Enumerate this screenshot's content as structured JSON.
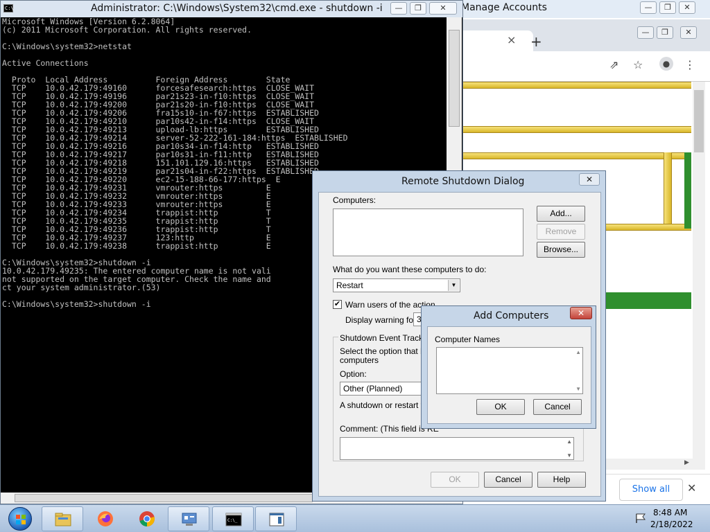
{
  "browser": {
    "title": "Manage Accounts",
    "tab_close": "×",
    "new_tab": "+",
    "show_all": "Show all",
    "download_close": "✕",
    "minimize": "—",
    "maximize": "❐",
    "close": "✕"
  },
  "cmd": {
    "title": "Administrator: C:\\Windows\\System32\\cmd.exe - shutdown  -i",
    "icon_text": "C:\\",
    "minimize": "—",
    "maximize": "❐",
    "close": "✕",
    "lines": [
      "Microsoft Windows [Version 6.2.8064]",
      "(c) 2011 Microsoft Corporation. All rights reserved.",
      "",
      "C:\\Windows\\system32>netstat",
      "",
      "Active Connections",
      "",
      "  Proto  Local Address          Foreign Address        State",
      "  TCP    10.0.42.179:49160      forcesafesearch:https  CLOSE_WAIT",
      "  TCP    10.0.42.179:49196      par21s23-in-f10:https  CLOSE_WAIT",
      "  TCP    10.0.42.179:49200      par21s20-in-f10:https  CLOSE_WAIT",
      "  TCP    10.0.42.179:49206      fra15s10-in-f67:https  ESTABLISHED",
      "  TCP    10.0.42.179:49210      par10s42-in-f14:https  CLOSE_WAIT",
      "  TCP    10.0.42.179:49213      upload-lb:https        ESTABLISHED",
      "  TCP    10.0.42.179:49214      server-52-222-161-184:https  ESTABLISHED",
      "  TCP    10.0.42.179:49216      par10s34-in-f14:http   ESTABLISHED",
      "  TCP    10.0.42.179:49217      par10s31-in-f11:http   ESTABLISHED",
      "  TCP    10.0.42.179:49218      151.101.129.16:https   ESTABLISHED",
      "  TCP    10.0.42.179:49219      par21s04-in-f22:https  ESTABLISHED",
      "  TCP    10.0.42.179:49220      ec2-15-188-66-177:https  E",
      "  TCP    10.0.42.179:49231      vmrouter:https         E",
      "  TCP    10.0.42.179:49232      vmrouter:https         E",
      "  TCP    10.0.42.179:49233      vmrouter:https         E",
      "  TCP    10.0.42.179:49234      trappist:http          T",
      "  TCP    10.0.42.179:49235      trappist:http          T",
      "  TCP    10.0.42.179:49236      trappist:http          T",
      "  TCP    10.0.42.179:49237      123:http               E",
      "  TCP    10.0.42.179:49238      trappist:http          E",
      "",
      "C:\\Windows\\system32>shutdown -i",
      "10.0.42.179.49235: The entered computer name is not vali",
      "not supported on the target computer. Check the name and",
      "ct your system administrator.(53)",
      "",
      "C:\\Windows\\system32>shutdown -i"
    ]
  },
  "remote_shutdown": {
    "title": "Remote Shutdown Dialog",
    "close": "✕",
    "computers_label": "Computers:",
    "add_button": "Add...",
    "remove_button": "Remove",
    "browse_button": "Browse...",
    "action_label": "What do you want these computers to do:",
    "action_value": "Restart",
    "warn_label": "Warn users of the action",
    "warn_checked": "✔",
    "display_warning_label": "Display warning for",
    "display_warning_value": "30",
    "tracker_group_label": "Shutdown Event Tracker",
    "tracker_desc_line1": "Select the option that bes",
    "tracker_desc_line2": "computers",
    "option_label": "Option:",
    "option_value": "Other (Planned)",
    "shutdown_desc": "A shutdown or restart for",
    "comment_label": "Comment: (This field is RE",
    "ok_button": "OK",
    "cancel_button": "Cancel",
    "help_button": "Help"
  },
  "add_computers": {
    "title": "Add Computers",
    "close": "✕",
    "names_label": "Computer Names",
    "names_value": "",
    "ok_button": "OK",
    "cancel_button": "Cancel"
  },
  "taskbar": {
    "time": "8:48 AM",
    "date": "2/18/2022",
    "items": [
      "start-button",
      "file-explorer",
      "firefox",
      "chrome",
      "control-panel",
      "command-prompt",
      "window-app"
    ]
  }
}
